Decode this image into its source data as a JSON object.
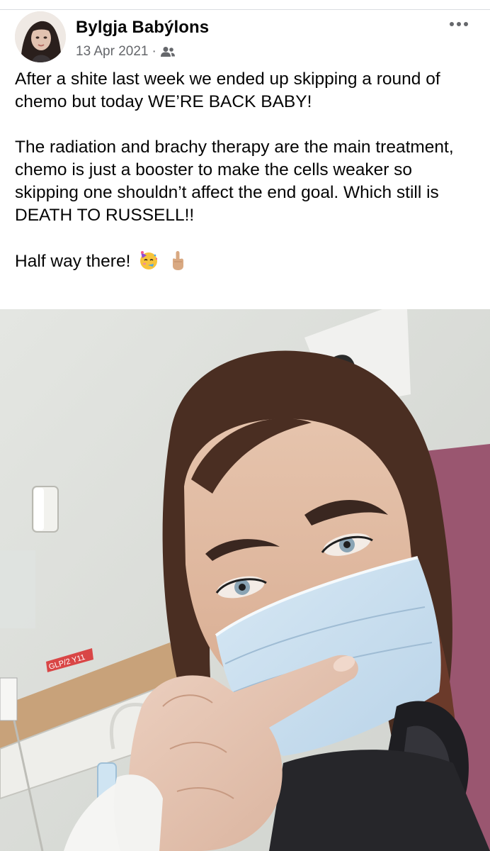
{
  "post": {
    "author": "Bylgja Babýlons",
    "date": "13 Apr 2021",
    "separator": "·",
    "audience_icon": "friends-icon",
    "more_icon": "more-horizontal-icon",
    "paragraphs": [
      "After a shite last week we ended up skipping a round of chemo but today WE’RE BACK BABY!",
      "The radiation and brachy therapy are the main treatment, chemo is just a booster to make the cells weaker so skipping one shouldn’t affect the end goal. Which still is DEATH TO RUSSELL!!",
      "Half way there!"
    ],
    "emojis": [
      "partying-face-emoji",
      "middle-finger-emoji"
    ],
    "photo": {
      "wall_label": "GLP/2 Y11"
    }
  },
  "colors": {
    "text_primary": "#050505",
    "text_secondary": "#65676b",
    "divider": "#dadde1",
    "mask_blue": "#c9dff0",
    "chair": "#9a5670"
  }
}
